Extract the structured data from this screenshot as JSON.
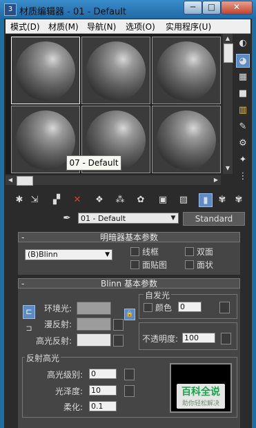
{
  "window": {
    "title": "材质编辑器 - 01 - Default",
    "app_icon": "3ds-max-icon",
    "minimize": "─",
    "maximize": "□",
    "close": "✕"
  },
  "menu": {
    "items": [
      "模式(D)",
      "材质(M)",
      "导航(N)",
      "选项(O)",
      "实用程序(U)"
    ]
  },
  "tooltip": "07 - Default",
  "material": {
    "name": "01 - Default",
    "type_button": "Standard"
  },
  "shader_rollout": {
    "title": "明暗器基本参数",
    "shader": "(B)Blinn",
    "checkboxes": [
      "线框",
      "双面",
      "面贴图",
      "面状"
    ]
  },
  "blinn_rollout": {
    "title": "Blinn 基本参数",
    "ambient_label": "环境光:",
    "diffuse_label": "漫反射:",
    "specular_label": "高光反射:",
    "self_illum": {
      "title": "自发光",
      "color_label": "颜色",
      "value": "0"
    },
    "opacity": {
      "label": "不透明度:",
      "value": "100"
    },
    "specular_highlights": {
      "title": "反射高光",
      "level_label": "高光级别:",
      "level_value": "0",
      "gloss_label": "光泽度:",
      "gloss_value": "10",
      "soften_label": "柔化:",
      "soften_value": "0.1"
    }
  },
  "colors": {
    "ambient": "#9c9c9c",
    "diffuse": "#9c9c9c",
    "specular": "#e6e6e6",
    "accent_blue": "#5b8cc5"
  },
  "watermark": {
    "title": "百科全说",
    "subtitle": "助你轻松解决"
  },
  "icons": {
    "side_column": [
      "sample-type-icon",
      "backlight-icon",
      "background-icon",
      "sample-uv-tiling-icon",
      "video-color-check-icon",
      "make-preview-icon",
      "options-icon",
      "select-by-material-icon",
      "material-map-navigator-icon"
    ],
    "toolbar": [
      "get-material-icon",
      "put-to-scene-icon",
      "assign-to-selection-icon",
      "reset-map-icon",
      "make-unique-icon",
      "put-to-library-icon",
      "material-id-channel-icon",
      "show-in-viewport-icon",
      "show-end-result-icon",
      "go-to-parent-icon",
      "go-forward-to-sibling-icon",
      "pick-from-object-icon"
    ]
  }
}
